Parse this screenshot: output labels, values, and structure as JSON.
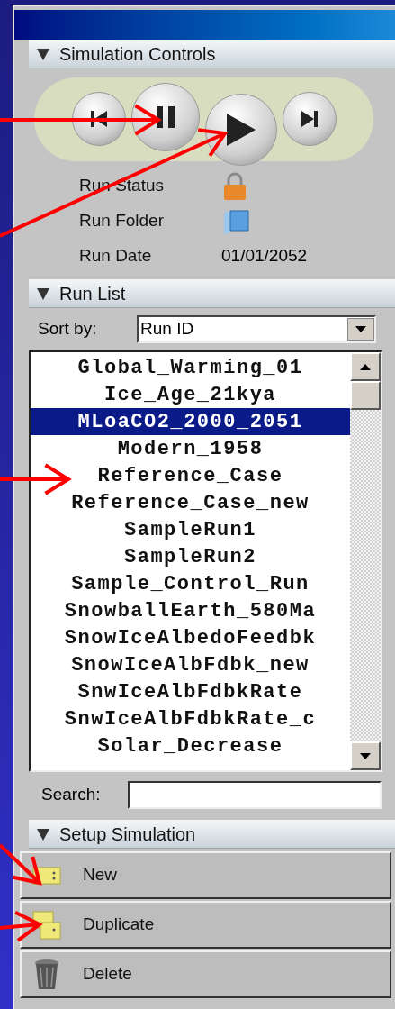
{
  "simulation_controls": {
    "title": "Simulation Controls",
    "expanded": true,
    "buttons": [
      {
        "kind": "previous"
      },
      {
        "kind": "pause"
      },
      {
        "kind": "play"
      },
      {
        "kind": "next"
      }
    ],
    "fields": [
      {
        "label": "Run Status",
        "kind": "lock"
      },
      {
        "label": "Run Folder",
        "kind": "folder"
      },
      {
        "label": "Run Date",
        "kind": "text",
        "value": "01/01/2052"
      }
    ]
  },
  "run_list": {
    "title": "Run List",
    "expanded": true,
    "sort_label": "Sort by:",
    "sort_value": "Run ID",
    "items": [
      {
        "label": "Global_Warming_01",
        "selected": false
      },
      {
        "label": "Ice_Age_21kya",
        "selected": false
      },
      {
        "label": "MLoaCO2_2000_2051",
        "selected": true
      },
      {
        "label": "Modern_1958",
        "selected": false
      },
      {
        "label": "Reference_Case",
        "selected": false
      },
      {
        "label": "Reference_Case_new",
        "selected": false
      },
      {
        "label": "SampleRun1",
        "selected": false
      },
      {
        "label": "SampleRun2",
        "selected": false
      },
      {
        "label": "Sample_Control_Run",
        "selected": false
      },
      {
        "label": "SnowballEarth_580Ma",
        "selected": false
      },
      {
        "label": "SnowIceAlbedoFeedbk",
        "selected": false
      },
      {
        "label": "SnowIceAlbFdbk_new",
        "selected": false
      },
      {
        "label": "SnwIceAlbFdbkRate",
        "selected": false
      },
      {
        "label": "SnwIceAlbFdbkRate_c",
        "selected": false
      },
      {
        "label": "Solar_Decrease",
        "selected": false
      }
    ],
    "search_label": "Search:"
  },
  "setup_simulation": {
    "title": "Setup Simulation",
    "expanded": true,
    "buttons": [
      {
        "label": "New",
        "kind": "new"
      },
      {
        "label": "Duplicate",
        "kind": "duplicate"
      },
      {
        "label": "Delete",
        "kind": "delete"
      }
    ]
  }
}
